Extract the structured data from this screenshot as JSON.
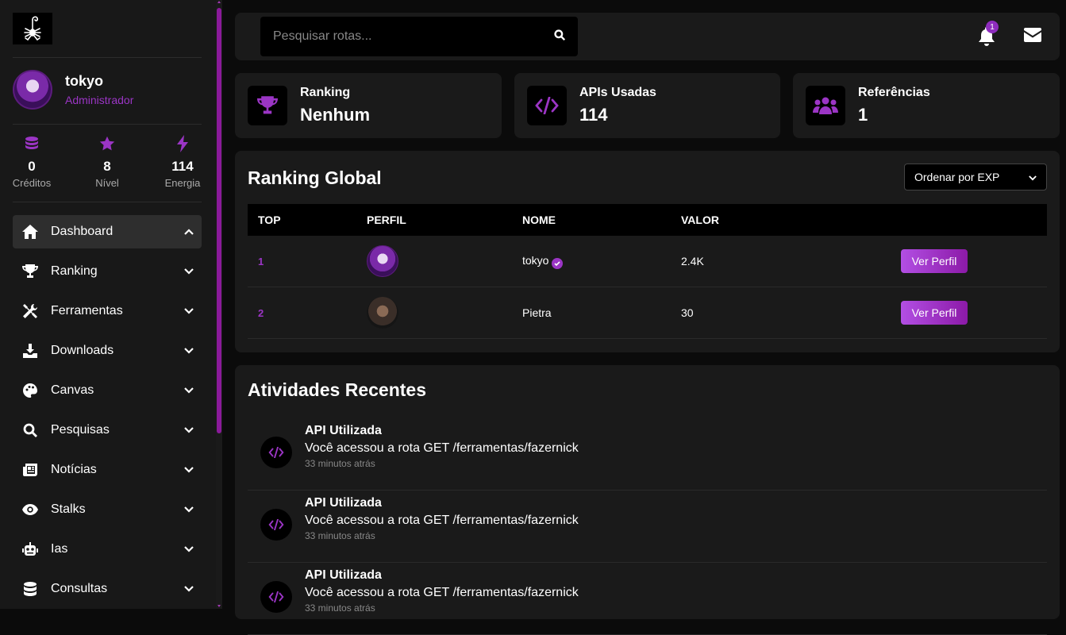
{
  "user": {
    "name": "tokyo",
    "role": "Administrador"
  },
  "stats": [
    {
      "value": "0",
      "label": "Créditos",
      "icon": "coins-icon"
    },
    {
      "value": "8",
      "label": "Nível",
      "icon": "star-icon"
    },
    {
      "value": "114",
      "label": "Energia",
      "icon": "bolt-icon"
    }
  ],
  "nav": [
    {
      "label": "Dashboard",
      "icon": "home-icon"
    },
    {
      "label": "Ranking",
      "icon": "trophy-icon"
    },
    {
      "label": "Ferramentas",
      "icon": "tools-icon"
    },
    {
      "label": "Downloads",
      "icon": "download-icon"
    },
    {
      "label": "Canvas",
      "icon": "palette-icon"
    },
    {
      "label": "Pesquisas",
      "icon": "search-icon"
    },
    {
      "label": "Notícias",
      "icon": "newspaper-icon"
    },
    {
      "label": "Stalks",
      "icon": "eye-icon"
    },
    {
      "label": "Ias",
      "icon": "robot-icon"
    },
    {
      "label": "Consultas",
      "icon": "database-icon"
    }
  ],
  "search": {
    "placeholder": "Pesquisar rotas..."
  },
  "notifications": {
    "count": "1"
  },
  "cards": [
    {
      "title": "Ranking",
      "value": "Nenhum"
    },
    {
      "title": "APIs Usadas",
      "value": "114"
    },
    {
      "title": "Referências",
      "value": "1"
    }
  ],
  "ranking": {
    "title": "Ranking Global",
    "sort_label": "Ordenar por EXP",
    "columns": [
      "TOP",
      "PERFIL",
      "NOME",
      "VALOR"
    ],
    "rows": [
      {
        "top": "1",
        "name": "tokyo",
        "value": "2.4K",
        "button": "Ver Perfil"
      },
      {
        "top": "2",
        "name": "Pietra",
        "value": "30",
        "button": "Ver Perfil"
      }
    ]
  },
  "activities": {
    "title": "Atividades Recentes",
    "items": [
      {
        "title": "API Utilizada",
        "desc": "Você acessou a rota GET /ferramentas/fazernick",
        "time": "33 minutos atrás"
      },
      {
        "title": "API Utilizada",
        "desc": "Você acessou a rota GET /ferramentas/fazernick",
        "time": "33 minutos atrás"
      },
      {
        "title": "API Utilizada",
        "desc": "Você acessou a rota GET /ferramentas/fazernick",
        "time": "33 minutos atrás"
      }
    ]
  },
  "colors": {
    "accent": "#9b35c5",
    "panel": "#1a1a1a",
    "background": "#0b0b0b"
  }
}
